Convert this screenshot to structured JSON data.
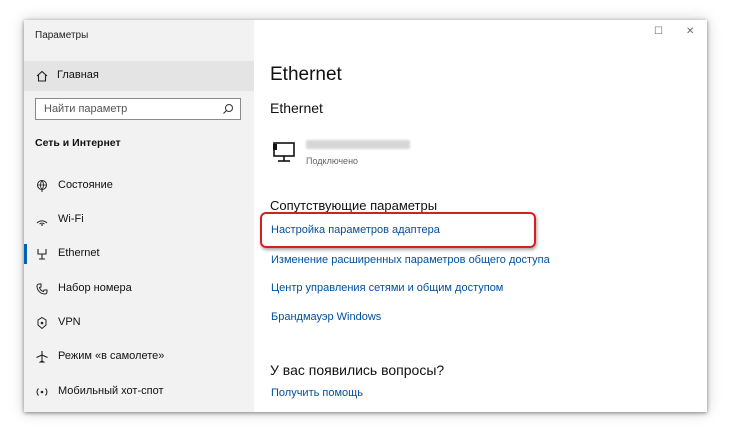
{
  "window": {
    "title": "Параметры",
    "controls": {
      "maximize": "☐",
      "close": "✕"
    }
  },
  "sidebar": {
    "home": {
      "label": "Главная",
      "icon": "home-icon"
    },
    "search": {
      "placeholder": "Найти параметр",
      "icon": "search-icon"
    },
    "section": "Сеть и Интернет",
    "items": [
      {
        "label": "Состояние",
        "icon": "globe-status-icon",
        "active": false
      },
      {
        "label": "Wi-Fi",
        "icon": "wifi-icon",
        "active": false
      },
      {
        "label": "Ethernet",
        "icon": "ethernet-icon",
        "active": true
      },
      {
        "label": "Набор номера",
        "icon": "dialup-phone-icon",
        "active": false
      },
      {
        "label": "VPN",
        "icon": "vpn-icon",
        "active": false
      },
      {
        "label": "Режим «в самолете»",
        "icon": "airplane-icon",
        "active": false
      },
      {
        "label": "Мобильный хот-спот",
        "icon": "hotspot-icon",
        "active": false
      }
    ]
  },
  "main": {
    "title": "Ethernet",
    "subtitle": "Ethernet",
    "connection": {
      "status": "Подключено",
      "icon": "network-computer-icon"
    },
    "related": {
      "heading": "Сопутствующие параметры",
      "links": [
        "Настройка параметров адаптера",
        "Изменение расширенных параметров общего доступа",
        "Центр управления сетями и общим доступом",
        "Брандмауэр Windows"
      ]
    },
    "questions": {
      "heading": "У вас появились вопросы?",
      "link": "Получить помощь"
    }
  },
  "colors": {
    "accent": "#0063b1",
    "link": "#0050a0",
    "highlight": "#d32020",
    "sidebar_bg": "#f2f2f2"
  }
}
